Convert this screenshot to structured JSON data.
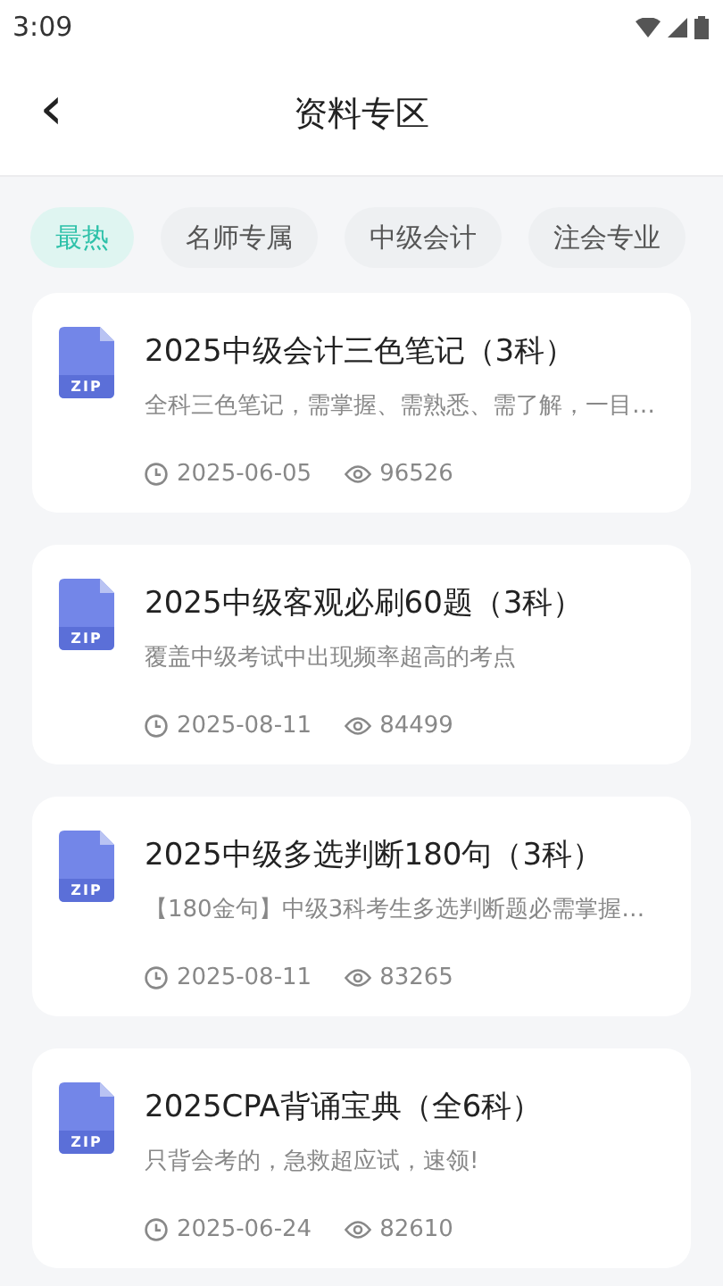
{
  "status_bar": {
    "time": "3:09"
  },
  "header": {
    "back": "‹",
    "title": "资料专区"
  },
  "tabs": [
    {
      "label": "最热",
      "selected": true
    },
    {
      "label": "名师专属",
      "selected": false
    },
    {
      "label": "中级会计",
      "selected": false
    },
    {
      "label": "注会专业",
      "selected": false
    }
  ],
  "items": [
    {
      "badge": "ZIP",
      "title": "2025中级会计三色笔记（3科）",
      "description": "全科三色笔记，需掌握、需熟悉、需了解，一目…",
      "date": "2025-06-05",
      "views": "96526"
    },
    {
      "badge": "ZIP",
      "title": "2025中级客观必刷60题（3科）",
      "description": "覆盖中级考试中出现频率超高的考点",
      "date": "2025-08-11",
      "views": "84499"
    },
    {
      "badge": "ZIP",
      "title": "2025中级多选判断180句（3科）",
      "description": "【180金句】中级3科考生多选判断题必需掌握…",
      "date": "2025-08-11",
      "views": "83265"
    },
    {
      "badge": "ZIP",
      "title": "2025CPA背诵宝典（全6科）",
      "description": "只背会考的，急救超应试，速领!",
      "date": "2025-06-24",
      "views": "82610"
    }
  ]
}
